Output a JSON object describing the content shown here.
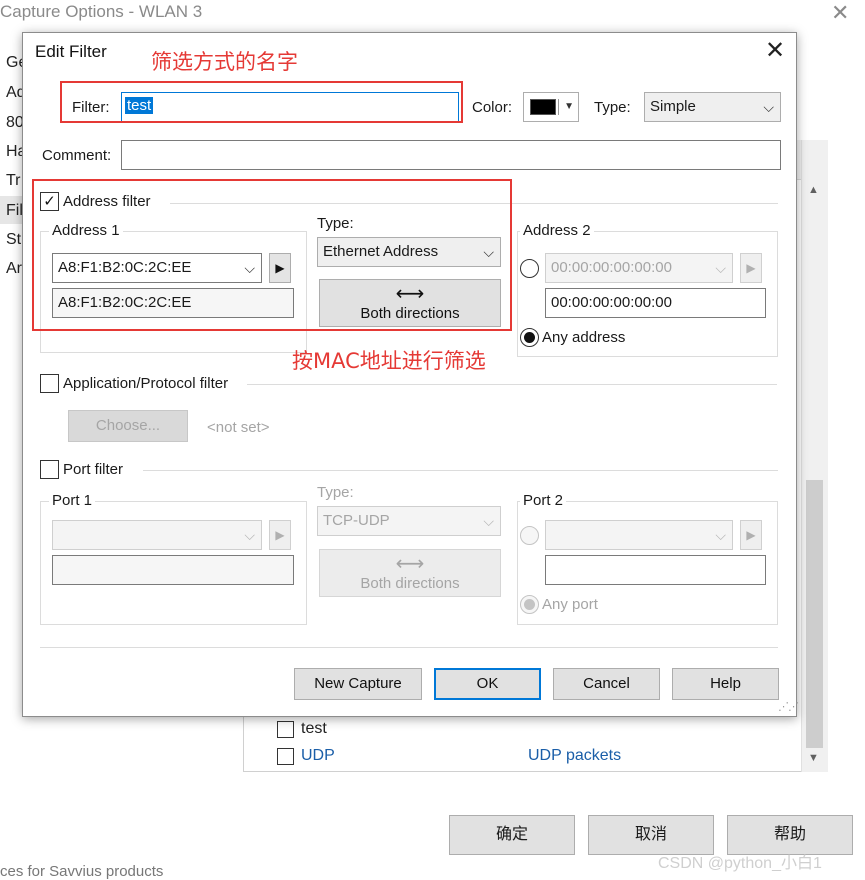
{
  "background_window": {
    "title": "Capture Options - WLAN 3",
    "sidebar_items": [
      "Ge",
      "Ad",
      "80",
      "Ha",
      "Tr",
      "Fil",
      "St",
      "Ar"
    ],
    "rows": [
      {
        "name": "test",
        "description": ""
      },
      {
        "name": "UDP",
        "description": "UDP packets"
      }
    ],
    "buttons": {
      "ok": "确定",
      "cancel": "取消",
      "help": "帮助"
    },
    "bottom_text": "ces for Savvius products"
  },
  "dialog": {
    "title": "Edit Filter",
    "filter_label": "Filter:",
    "filter_value": "test",
    "color_label": "Color:",
    "color_value": "#000000",
    "type_label": "Type:",
    "type_value": "Simple",
    "comment_label": "Comment:",
    "comment_value": "",
    "address_filter": {
      "label": "Address filter",
      "checked": true,
      "address1_label": "Address 1",
      "address1_value": "A8:F1:B2:0C:2C:EE",
      "address1_display": "A8:F1:B2:0C:2C:EE",
      "type_label": "Type:",
      "type_value": "Ethernet Address",
      "direction_label": "Both directions",
      "address2_label": "Address 2",
      "address2_value": "00:00:00:00:00:00",
      "address2_display": "00:00:00:00:00:00",
      "any_address_label": "Any address"
    },
    "app_filter": {
      "label": "Application/Protocol filter",
      "checked": false,
      "choose_label": "Choose...",
      "not_set": "<not set>"
    },
    "port_filter": {
      "label": "Port filter",
      "checked": false,
      "port1_label": "Port 1",
      "type_label": "Type:",
      "type_value": "TCP-UDP",
      "direction_label": "Both directions",
      "port2_label": "Port 2",
      "any_port_label": "Any port"
    },
    "buttons": {
      "new_capture": "New Capture",
      "ok": "OK",
      "cancel": "Cancel",
      "help": "Help"
    }
  },
  "annotations": {
    "filter_name_note": "筛选方式的名字",
    "mac_filter_note": "按MAC地址进行筛选"
  },
  "watermark": "CSDN @python_小白1"
}
